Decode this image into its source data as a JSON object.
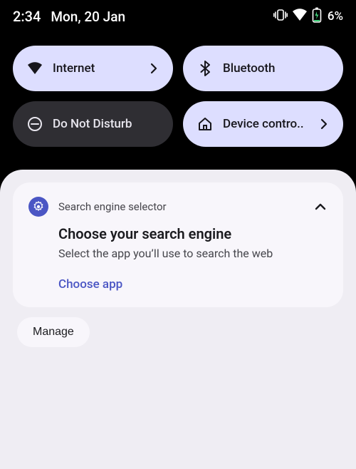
{
  "status": {
    "time": "2:34",
    "date": "Mon, 20 Jan",
    "battery_pct": "6%",
    "icons": {
      "vibrate": "vibrate-icon",
      "wifi": "wifi-icon",
      "battery": "battery-icon"
    }
  },
  "qs": {
    "tiles": [
      {
        "label": "Internet",
        "icon": "wifi-icon",
        "active": true,
        "chevron": true
      },
      {
        "label": "Bluetooth",
        "icon": "bluetooth-icon",
        "active": true,
        "chevron": false
      },
      {
        "label": "Do Not Disturb",
        "icon": "dnd-icon",
        "active": false,
        "chevron": false
      },
      {
        "label": "Device contro..",
        "icon": "home-icon",
        "active": true,
        "chevron": true
      }
    ]
  },
  "notification": {
    "app_name": "Search engine selector",
    "app_icon": "gear-icon",
    "title": "Choose your search engine",
    "text": "Select the app you’ll use to search the web",
    "action": "Choose app"
  },
  "footer": {
    "manage_label": "Manage"
  }
}
